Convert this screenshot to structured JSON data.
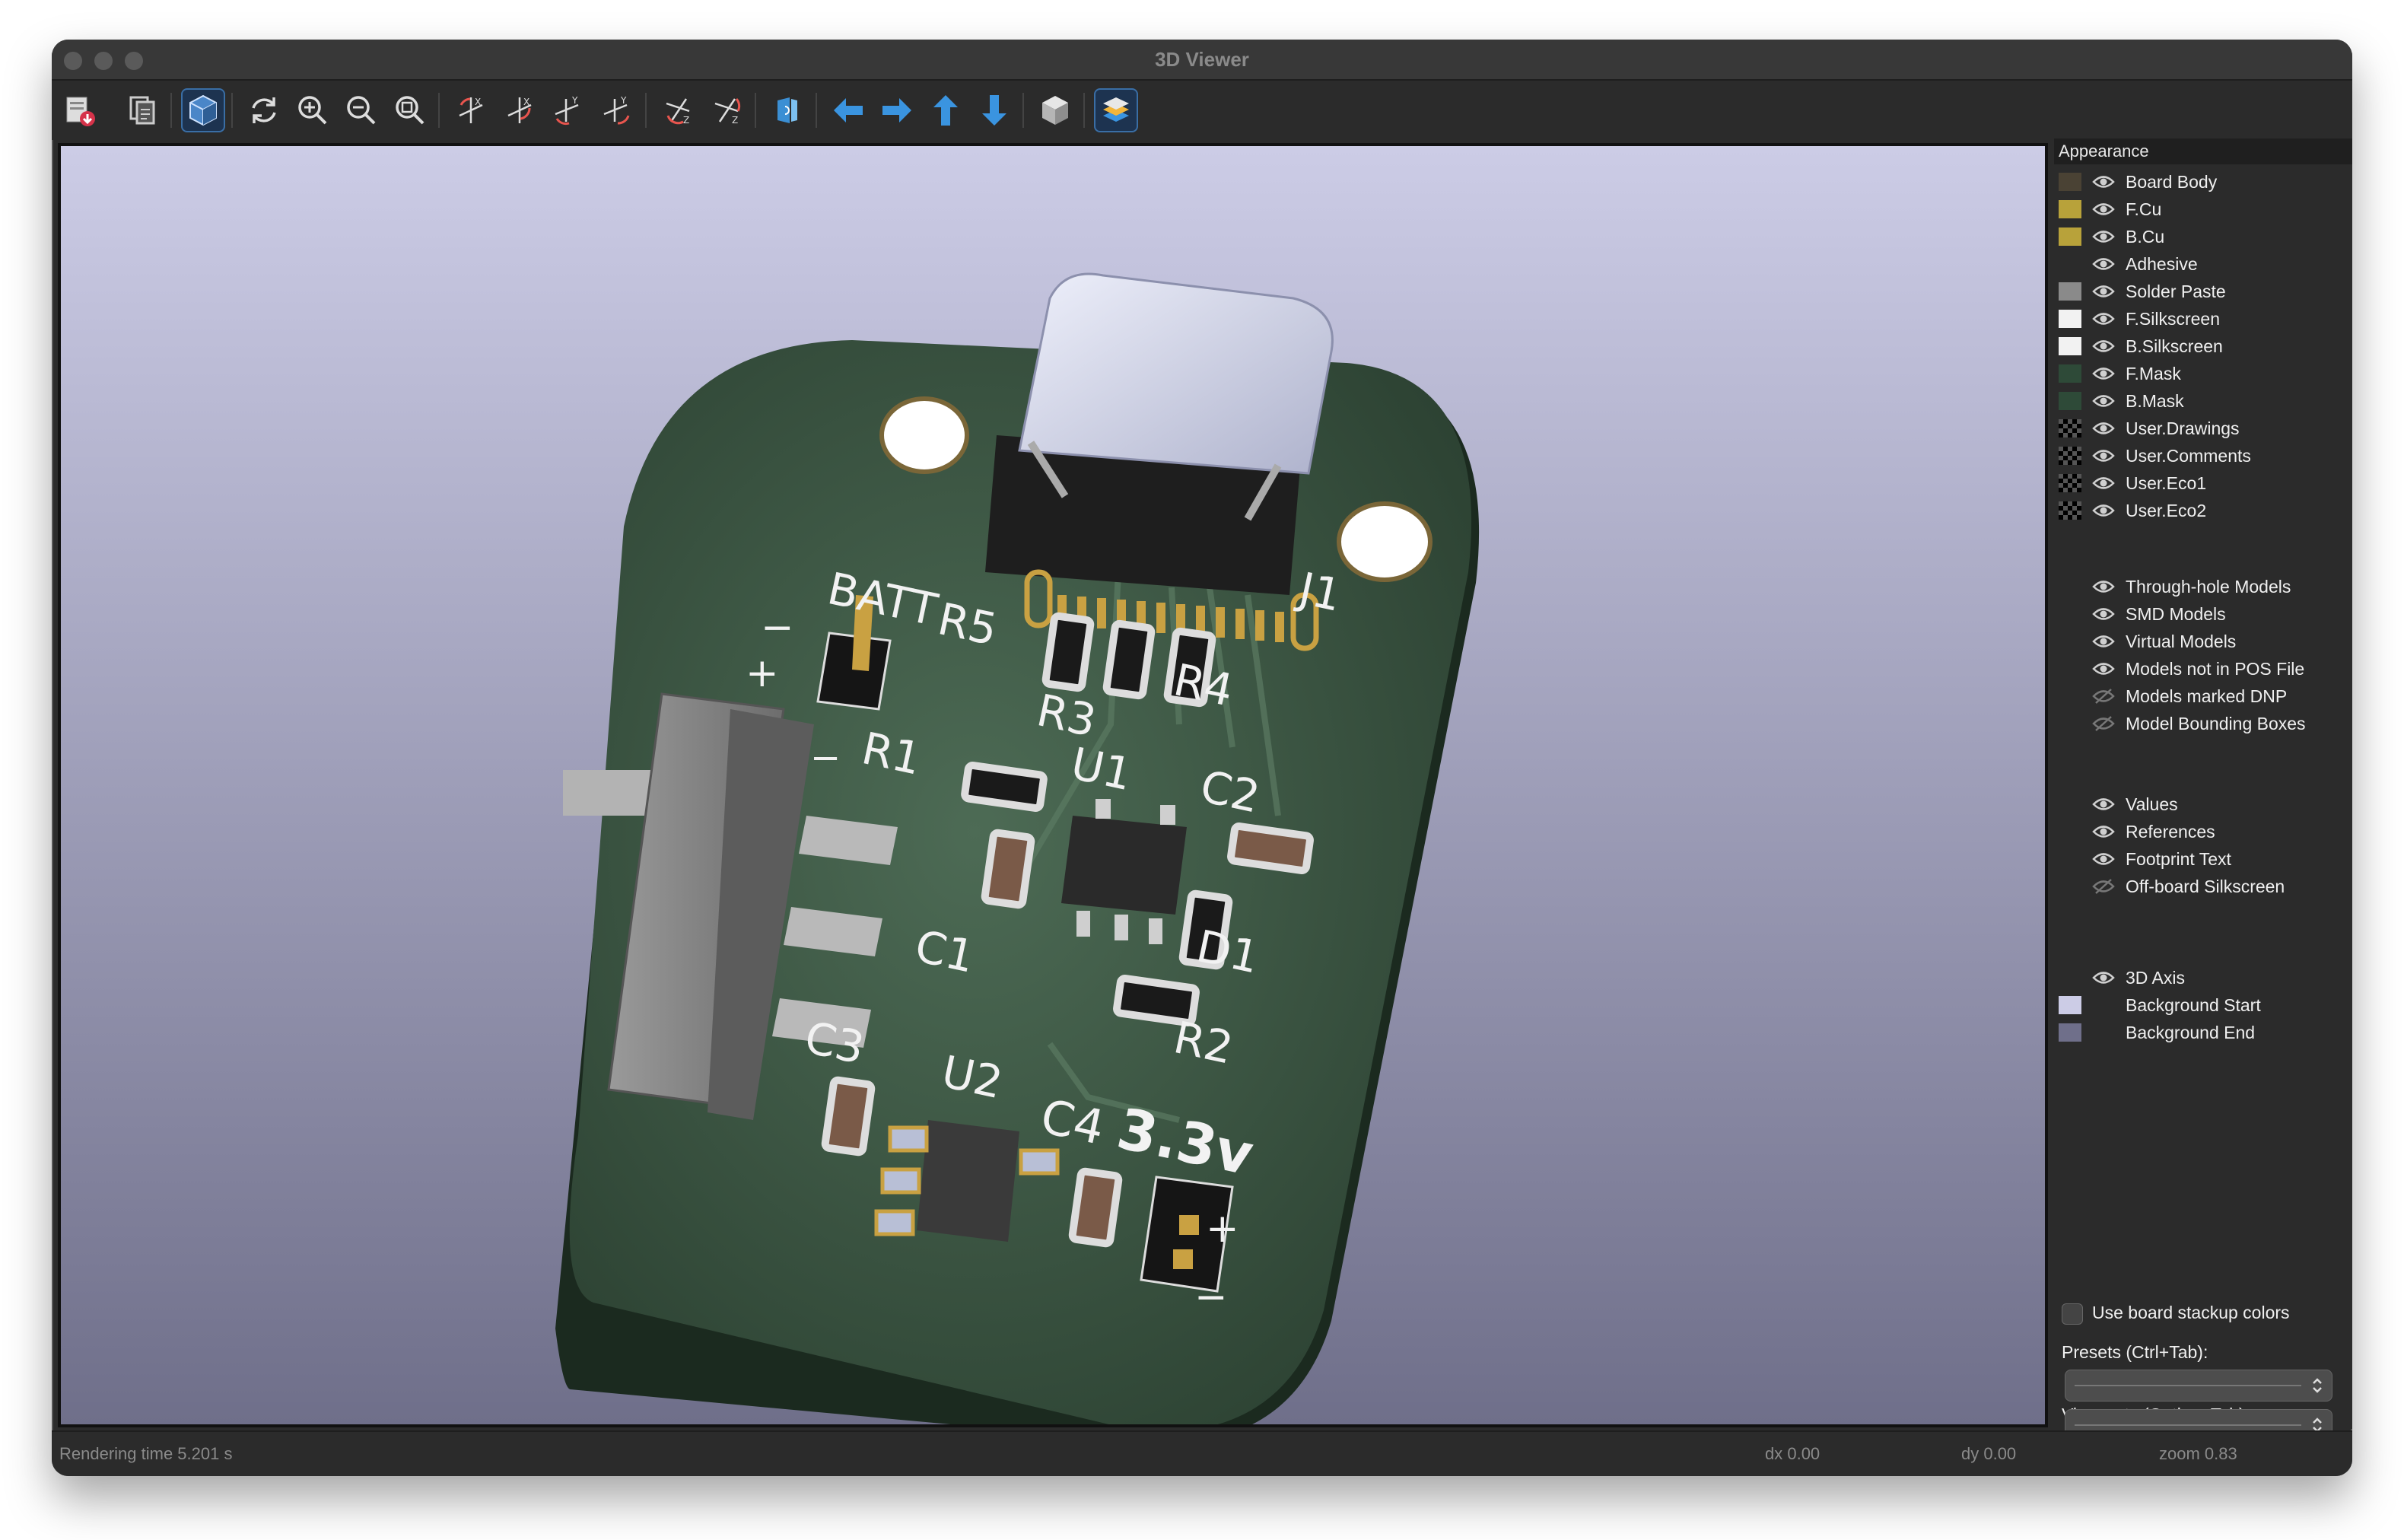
{
  "window": {
    "title": "3D Viewer"
  },
  "toolbar": {
    "buttons": [
      {
        "name": "export-image-button",
        "icon": "export-image-icon"
      },
      {
        "name": "copy-clipboard-button",
        "icon": "copy-icon"
      },
      {
        "name": "toggle-raytracing-button",
        "icon": "cube-toggle-icon",
        "active": true
      },
      {
        "name": "reload-button",
        "icon": "refresh-icon"
      },
      {
        "name": "zoom-in-button",
        "icon": "zoom-in-icon"
      },
      {
        "name": "zoom-out-button",
        "icon": "zoom-out-icon"
      },
      {
        "name": "zoom-fit-button",
        "icon": "zoom-fit-icon"
      },
      {
        "name": "rotate-x-cw-button",
        "icon": "rotate-x-cw-icon"
      },
      {
        "name": "rotate-x-ccw-button",
        "icon": "rotate-x-ccw-icon"
      },
      {
        "name": "rotate-y-cw-button",
        "icon": "rotate-y-cw-icon"
      },
      {
        "name": "rotate-y-ccw-button",
        "icon": "rotate-y-ccw-icon"
      },
      {
        "name": "rotate-z-cw-button",
        "icon": "rotate-z-cw-icon"
      },
      {
        "name": "rotate-z-ccw-button",
        "icon": "rotate-z-ccw-icon"
      },
      {
        "name": "flip-board-button",
        "icon": "flip-board-icon"
      },
      {
        "name": "move-left-button",
        "icon": "arrow-left-icon"
      },
      {
        "name": "move-right-button",
        "icon": "arrow-right-icon"
      },
      {
        "name": "move-up-button",
        "icon": "arrow-up-icon"
      },
      {
        "name": "move-down-button",
        "icon": "arrow-down-icon"
      },
      {
        "name": "orthographic-button",
        "icon": "ortho-cube-icon"
      },
      {
        "name": "layers-manager-button",
        "icon": "layers-icon",
        "active": true
      }
    ]
  },
  "board": {
    "silkscreen": [
      "BATT",
      "R5",
      "R4",
      "R3",
      "R1",
      "U1",
      "C2",
      "C1",
      "D1",
      "R2",
      "C3",
      "U2",
      "C4",
      "3.3v",
      "J1",
      "+",
      "+",
      "−",
      "−",
      "−"
    ]
  },
  "appearance": {
    "title": "Appearance",
    "layers": [
      {
        "label": "Board Body",
        "color": "#4a4234",
        "eye": true
      },
      {
        "label": "F.Cu",
        "color": "#b8a23a",
        "eye": true
      },
      {
        "label": "B.Cu",
        "color": "#b8a23a",
        "eye": true
      },
      {
        "label": "Adhesive",
        "color": "",
        "eye": true
      },
      {
        "label": "Solder Paste",
        "color": "#8a8a8a",
        "eye": true
      },
      {
        "label": "F.Silkscreen",
        "color": "#f2f2f2",
        "eye": true
      },
      {
        "label": "B.Silkscreen",
        "color": "#f2f2f2",
        "eye": true
      },
      {
        "label": "F.Mask",
        "color": "#2e4a38",
        "eye": true
      },
      {
        "label": "B.Mask",
        "color": "#2e4a38",
        "eye": true
      },
      {
        "label": "User.Drawings",
        "color": "checker",
        "eye": true
      },
      {
        "label": "User.Comments",
        "color": "checker",
        "eye": true
      },
      {
        "label": "User.Eco1",
        "color": "checker",
        "eye": true
      },
      {
        "label": "User.Eco2",
        "color": "checker",
        "eye": true
      }
    ],
    "models": [
      {
        "label": "Through-hole Models",
        "eye": true
      },
      {
        "label": "SMD Models",
        "eye": true
      },
      {
        "label": "Virtual Models",
        "eye": true
      },
      {
        "label": "Models not in POS File",
        "eye": true
      },
      {
        "label": "Models marked DNP",
        "eye": false
      },
      {
        "label": "Model Bounding Boxes",
        "eye": false
      }
    ],
    "text": [
      {
        "label": "Values",
        "eye": true
      },
      {
        "label": "References",
        "eye": true
      },
      {
        "label": "Footprint Text",
        "eye": true
      },
      {
        "label": "Off-board Silkscreen",
        "eye": false
      }
    ],
    "misc": [
      {
        "label": "3D Axis",
        "color": "",
        "eye": true
      },
      {
        "label": "Background Start",
        "color": "#cccce6",
        "eye": null
      },
      {
        "label": "Background End",
        "color": "#6f6f8a",
        "eye": null
      }
    ],
    "use_stackup_colors": "Use board stackup colors",
    "presets_label": "Presets (Ctrl+Tab):",
    "presets_value": "",
    "viewports_label": "Viewports (Option+Tab):",
    "viewports_value": ""
  },
  "status": {
    "render_time": "Rendering time 5.201 s",
    "dx": "dx 0.00",
    "dy": "dy 0.00",
    "zoom": "zoom 0.83"
  }
}
